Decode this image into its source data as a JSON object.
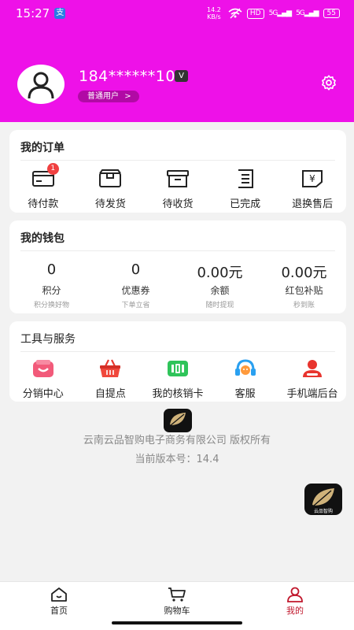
{
  "status_bar": {
    "time": "15:27",
    "app_badge": "支",
    "network_speed": "14.2 KB/s",
    "hd_badge": "HD",
    "signal_1": "5G",
    "signal_2": "5G",
    "battery": "55"
  },
  "profile": {
    "username": "184******10",
    "vip_flag": "V",
    "level": "普通用户",
    "level_chevron": ">"
  },
  "orders": {
    "title": "我的订单",
    "items": [
      {
        "label": "待付款",
        "icon": "card-payment-icon",
        "badge": "1"
      },
      {
        "label": "待发货",
        "icon": "package-box-icon"
      },
      {
        "label": "待收货",
        "icon": "archive-box-icon"
      },
      {
        "label": "已完成",
        "icon": "completed-list-icon"
      },
      {
        "label": "退换售后",
        "icon": "refund-yen-icon"
      }
    ]
  },
  "wallet": {
    "title": "我的钱包",
    "items": [
      {
        "value": "0",
        "label": "积分",
        "sub": "积分换好物"
      },
      {
        "value": "0",
        "label": "优惠券",
        "sub": "下单立省"
      },
      {
        "value": "0.00元",
        "label": "余额",
        "sub": "随时提现"
      },
      {
        "value": "0.00元",
        "label": "红包补贴",
        "sub": "秒到账"
      }
    ]
  },
  "tools": {
    "title": "工具与服务",
    "items": [
      {
        "label": "分销中心",
        "icon": "distribution-center-icon"
      },
      {
        "label": "自提点",
        "icon": "shopping-basket-icon"
      },
      {
        "label": "我的核销卡",
        "icon": "verification-card-icon"
      },
      {
        "label": "客服",
        "icon": "headset-icon"
      },
      {
        "label": "手机端后台",
        "icon": "admin-person-icon"
      }
    ]
  },
  "footer": {
    "company": "云南云品智购电子商务有限公司 版权所有",
    "version": "当前版本号：14.4",
    "logo_text": "云品智购"
  },
  "tabbar": {
    "items": [
      {
        "label": "首页",
        "icon": "home-icon",
        "active": false
      },
      {
        "label": "购物车",
        "icon": "cart-icon",
        "active": false
      },
      {
        "label": "我的",
        "icon": "user-icon",
        "active": true
      }
    ]
  },
  "colors": {
    "header_bg": "#ee11e8",
    "level_pill": "#b10aa5",
    "badge_red": "#f04040",
    "active_tab": "#c0172c"
  }
}
